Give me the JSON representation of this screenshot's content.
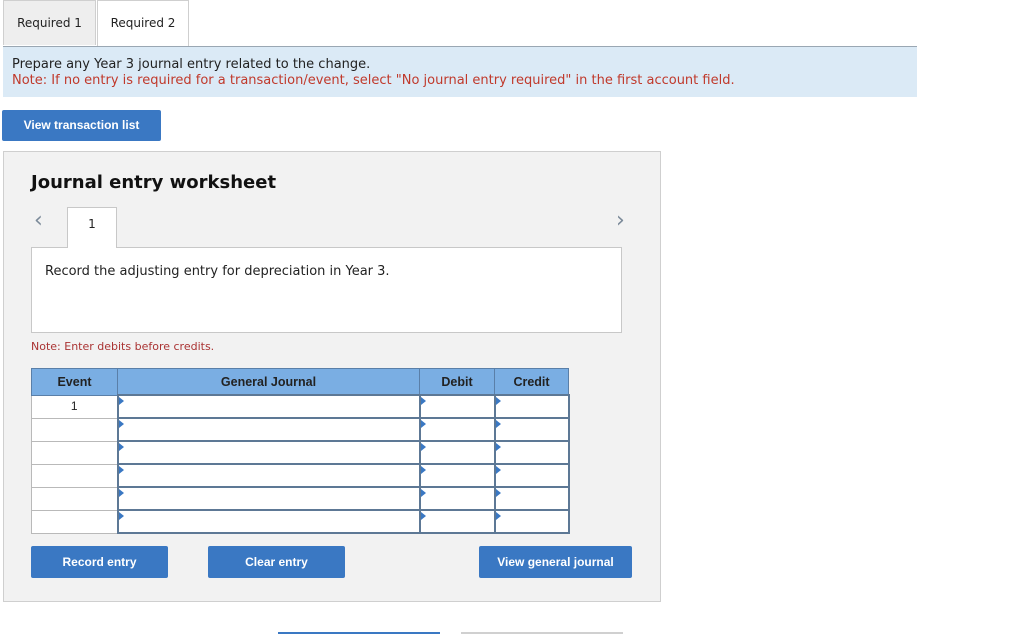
{
  "tabs": [
    {
      "label": "Required 1",
      "active": false
    },
    {
      "label": "Required 2",
      "active": true
    }
  ],
  "instructions": {
    "main": "Prepare any Year 3 journal entry related to the change.",
    "note": "Note: If no entry is required for a transaction/event, select \"No journal entry required\" in the first account field."
  },
  "buttons": {
    "view_transactions": "View transaction list",
    "record_entry": "Record entry",
    "clear_entry": "Clear entry",
    "view_general_journal": "View general journal"
  },
  "worksheet": {
    "title": "Journal entry worksheet",
    "current_page": "1",
    "description": "Record the adjusting entry for depreciation in Year 3.",
    "note": "Note: Enter debits before credits."
  },
  "journal_table": {
    "headers": {
      "event": "Event",
      "general_journal": "General Journal",
      "debit": "Debit",
      "credit": "Credit"
    },
    "rows": [
      {
        "event": "1",
        "account": "",
        "debit": "",
        "credit": ""
      },
      {
        "event": "",
        "account": "",
        "debit": "",
        "credit": ""
      },
      {
        "event": "",
        "account": "",
        "debit": "",
        "credit": ""
      },
      {
        "event": "",
        "account": "",
        "debit": "",
        "credit": ""
      },
      {
        "event": "",
        "account": "",
        "debit": "",
        "credit": ""
      },
      {
        "event": "",
        "account": "",
        "debit": "",
        "credit": ""
      }
    ]
  },
  "colors": {
    "accent": "#3a78c3",
    "banner": "#dbeaf6",
    "header": "#7aaee3",
    "note": "#c0392b"
  }
}
